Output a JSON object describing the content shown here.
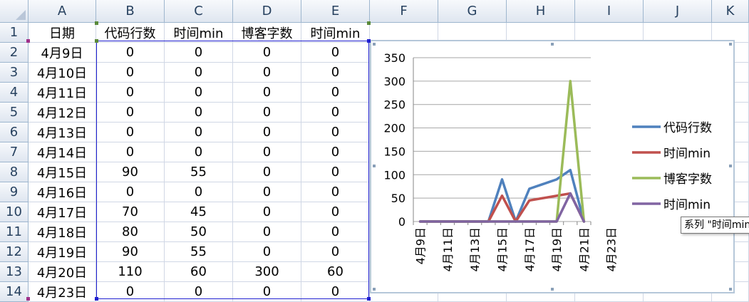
{
  "spreadsheet": {
    "columns": [
      "A",
      "B",
      "C",
      "D",
      "E",
      "F",
      "G",
      "H",
      "I",
      "J",
      "K"
    ],
    "rows": [
      "1",
      "2",
      "3",
      "4",
      "5",
      "6",
      "7",
      "8",
      "9",
      "10",
      "11",
      "12",
      "13",
      "14"
    ],
    "cells": [
      [
        "日期",
        "代码行数",
        "时间min",
        "博客字数",
        "时间min"
      ],
      [
        "4月9日",
        "0",
        "0",
        "0",
        "0"
      ],
      [
        "4月10日",
        "0",
        "0",
        "0",
        "0"
      ],
      [
        "4月11日",
        "0",
        "0",
        "0",
        "0"
      ],
      [
        "4月12日",
        "0",
        "0",
        "0",
        "0"
      ],
      [
        "4月13日",
        "0",
        "0",
        "0",
        "0"
      ],
      [
        "4月14日",
        "0",
        "0",
        "0",
        "0"
      ],
      [
        "4月15日",
        "90",
        "55",
        "0",
        "0"
      ],
      [
        "4月16日",
        "0",
        "0",
        "0",
        "0"
      ],
      [
        "4月17日",
        "70",
        "45",
        "0",
        "0"
      ],
      [
        "4月18日",
        "80",
        "50",
        "0",
        "0"
      ],
      [
        "4月19日",
        "90",
        "55",
        "0",
        "0"
      ],
      [
        "4月20日",
        "110",
        "60",
        "300",
        "60"
      ],
      [
        "4月23日",
        "0",
        "0",
        "0",
        "0"
      ]
    ]
  },
  "chart_data": {
    "type": "line",
    "categories": [
      "4月9日",
      "4月10日",
      "4月11日",
      "4月12日",
      "4月13日",
      "4月14日",
      "4月15日",
      "4月16日",
      "4月17日",
      "4月18日",
      "4月19日",
      "4月20日",
      "4月23日"
    ],
    "x_tick_labels": [
      "4月9日",
      "4月11日",
      "4月13日",
      "4月15日",
      "4月17日",
      "4月19日",
      "4月21日",
      "4月23日"
    ],
    "y_ticks": [
      "0",
      "50",
      "100",
      "150",
      "200",
      "250",
      "300",
      "350"
    ],
    "ylim": [
      0,
      350
    ],
    "grid": true,
    "legend_position": "right",
    "series": [
      {
        "name": "代码行数",
        "color": "#4f81bd",
        "values": [
          0,
          0,
          0,
          0,
          0,
          0,
          90,
          0,
          70,
          80,
          90,
          110,
          0
        ]
      },
      {
        "name": "时间min",
        "color": "#c0504d",
        "values": [
          0,
          0,
          0,
          0,
          0,
          0,
          55,
          0,
          45,
          50,
          55,
          60,
          0
        ]
      },
      {
        "name": "博客字数",
        "color": "#9bbb59",
        "values": [
          0,
          0,
          0,
          0,
          0,
          0,
          0,
          0,
          0,
          0,
          0,
          300,
          0
        ]
      },
      {
        "name": "时间min",
        "color": "#8064a2",
        "values": [
          0,
          0,
          0,
          0,
          0,
          0,
          0,
          0,
          0,
          0,
          0,
          60,
          0
        ]
      }
    ]
  },
  "tooltip": {
    "text": "系列 \"时间min\""
  }
}
